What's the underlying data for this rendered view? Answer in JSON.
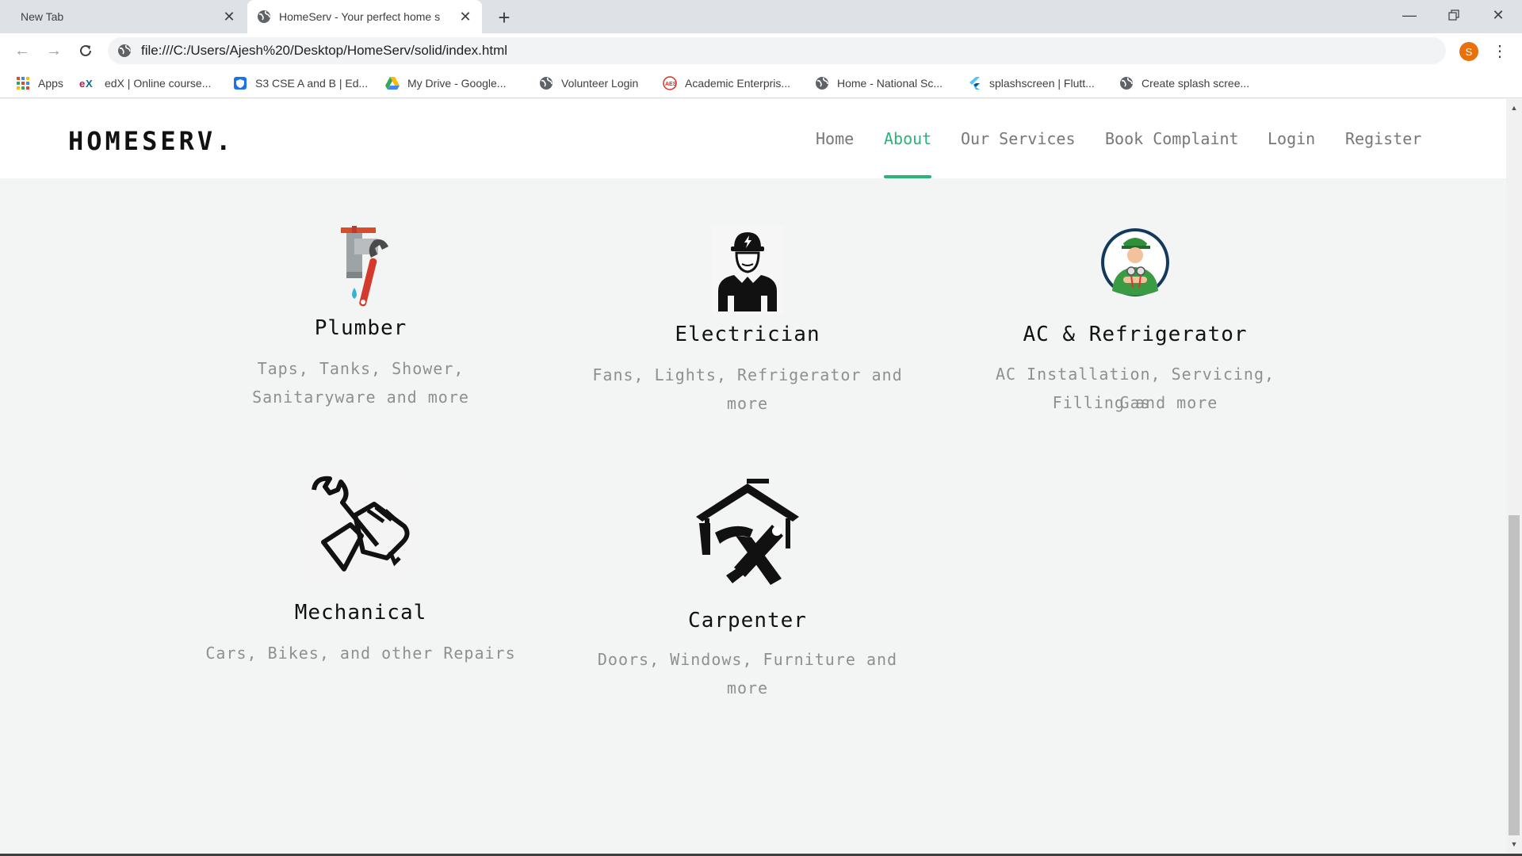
{
  "browser": {
    "tabs": [
      {
        "title": "New Tab",
        "active": false
      },
      {
        "title": "HomeServ - Your perfect home s",
        "active": true
      }
    ],
    "new_tab_label": "+",
    "url": "file:///C:/Users/Ajesh%20/Desktop/HomeServ/solid/index.html",
    "profile_initial": "S",
    "bookmarks": [
      {
        "label": "Apps",
        "icon": "apps-grid-icon"
      },
      {
        "label": "edX | Online course...",
        "icon": "edx-icon"
      },
      {
        "label": "S3 CSE A and B | Ed...",
        "icon": "shield-icon"
      },
      {
        "label": "My Drive - Google...",
        "icon": "google-drive-icon"
      },
      {
        "label": "Volunteer Login",
        "icon": "globe-icon"
      },
      {
        "label": "Academic Enterpris...",
        "icon": "academic-icon"
      },
      {
        "label": "Home - National Sc...",
        "icon": "globe-icon"
      },
      {
        "label": "splashscreen | Flutt...",
        "icon": "flutter-icon"
      },
      {
        "label": "Create splash scree...",
        "icon": "globe-icon"
      }
    ]
  },
  "site": {
    "brand": "HOMESERV.",
    "nav": [
      {
        "label": "Home",
        "active": false
      },
      {
        "label": "About",
        "active": true
      },
      {
        "label": "Our Services",
        "active": false
      },
      {
        "label": "Book Complaint",
        "active": false
      },
      {
        "label": "Login",
        "active": false
      },
      {
        "label": "Register",
        "active": false
      }
    ],
    "accent_color": "#2ab27b"
  },
  "services": [
    {
      "title": "Plumber",
      "desc_line1": "Taps, Tanks, Shower,",
      "desc_line2": "Sanitaryware and more",
      "icon": "plumber-tap-wrench-icon"
    },
    {
      "title": "Electrician",
      "desc_line1": "Fans, Lights, Refrigerator and",
      "desc_line2": "more",
      "icon": "electrician-worker-icon"
    },
    {
      "title": "AC & Refrigerator",
      "desc_line1": "AC Installation, Servicing, Gas",
      "desc_line2": "Filling and more",
      "icon": "ac-technician-icon"
    },
    {
      "title": "Mechanical",
      "desc_line1": "Cars, Bikes, and other Repairs",
      "desc_line2": "",
      "icon": "mechanic-hand-wrench-icon"
    },
    {
      "title": "Carpenter",
      "desc_line1": "Doors, Windows, Furniture and",
      "desc_line2": "more",
      "icon": "carpenter-house-tools-icon"
    }
  ]
}
